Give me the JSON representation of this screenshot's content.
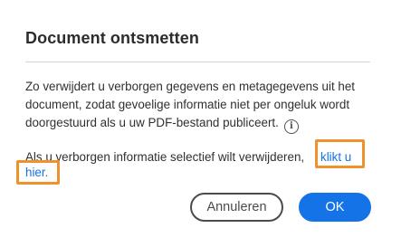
{
  "dialog": {
    "title": "Document ontsmetten",
    "description": "Zo verwijdert u verborgen gegevens en metagegevens uit het document, zodat gevoelige informatie niet per ongeluk wordt doorgestuurd als u uw PDF-bestand publiceert.",
    "info_icon": "info-icon",
    "selective_text": "Als u verborgen informatie selectief wilt verwijderen,",
    "link_part1": "klikt u",
    "link_part2": "hier.",
    "cancel_label": "Annuleren",
    "ok_label": "OK"
  },
  "colors": {
    "accent": "#1473e6",
    "highlight": "#f0922b",
    "text": "#303030"
  }
}
